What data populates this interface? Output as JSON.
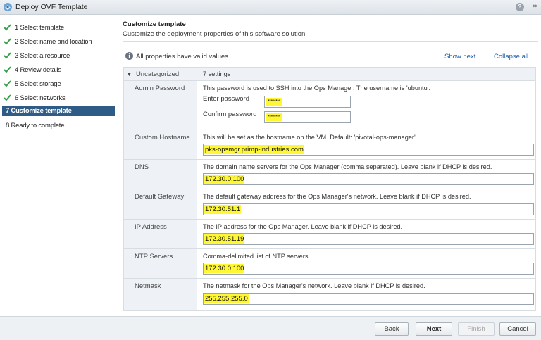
{
  "window": {
    "title": "Deploy OVF Template",
    "help_icon": "question-icon",
    "help_glyph": "?",
    "expand_icon": "double-chevron-right-icon",
    "expand_glyph": "▸▸"
  },
  "steps": [
    {
      "label": "1  Select template",
      "status": "done"
    },
    {
      "label": "2  Select name and location",
      "status": "done"
    },
    {
      "label": "3  Select a resource",
      "status": "done"
    },
    {
      "label": "4  Review details",
      "status": "done"
    },
    {
      "label": "5  Select storage",
      "status": "done"
    },
    {
      "label": "6  Select networks",
      "status": "done"
    },
    {
      "label": "7  Customize template",
      "status": "active"
    },
    {
      "label": "8  Ready to complete",
      "status": "pending"
    }
  ],
  "main": {
    "title": "Customize template",
    "subtitle": "Customize the deployment properties of this software solution.",
    "info_glyph": "i",
    "info_text": "All properties have valid values",
    "show_next": "Show next...",
    "collapse_all": "Collapse all..."
  },
  "category": {
    "name": "Uncategorized",
    "count": "7 settings",
    "caret": "▼"
  },
  "admin_password": {
    "key": "Admin Password",
    "description": "This password is used to SSH into the Ops Manager. The username is 'ubuntu'.",
    "enter_label": "Enter password",
    "enter_value": "********",
    "confirm_label": "Confirm password",
    "confirm_value": "********"
  },
  "fields": [
    {
      "key": "Custom Hostname",
      "description": "This will be set as the hostname on the VM. Default: 'pivotal-ops-manager'.",
      "value": "pks-opsmgr.primp-industries.com"
    },
    {
      "key": "DNS",
      "description": "The domain name servers for the Ops Manager (comma separated). Leave blank if DHCP is desired.",
      "value": "172.30.0.100"
    },
    {
      "key": "Default Gateway",
      "description": "The default gateway address for the Ops Manager's network. Leave blank if DHCP is desired.",
      "value": "172.30.51.1"
    },
    {
      "key": "IP Address",
      "description": "The IP address for the Ops Manager. Leave blank if DHCP is desired.",
      "value": "172.30.51.19"
    },
    {
      "key": "NTP Servers",
      "description": "Comma-delimited list of NTP servers",
      "value": "172.30.0.100"
    },
    {
      "key": "Netmask",
      "description": "The netmask for the Ops Manager's network. Leave blank if DHCP is desired.",
      "value": "255.255.255.0"
    }
  ],
  "footer": {
    "back": "Back",
    "next": "Next",
    "finish": "Finish",
    "cancel": "Cancel"
  },
  "colors": {
    "active_step": "#2f5c87",
    "check_green": "#3aa14a",
    "highlight": "#fff733",
    "link": "#1f5fa8"
  }
}
